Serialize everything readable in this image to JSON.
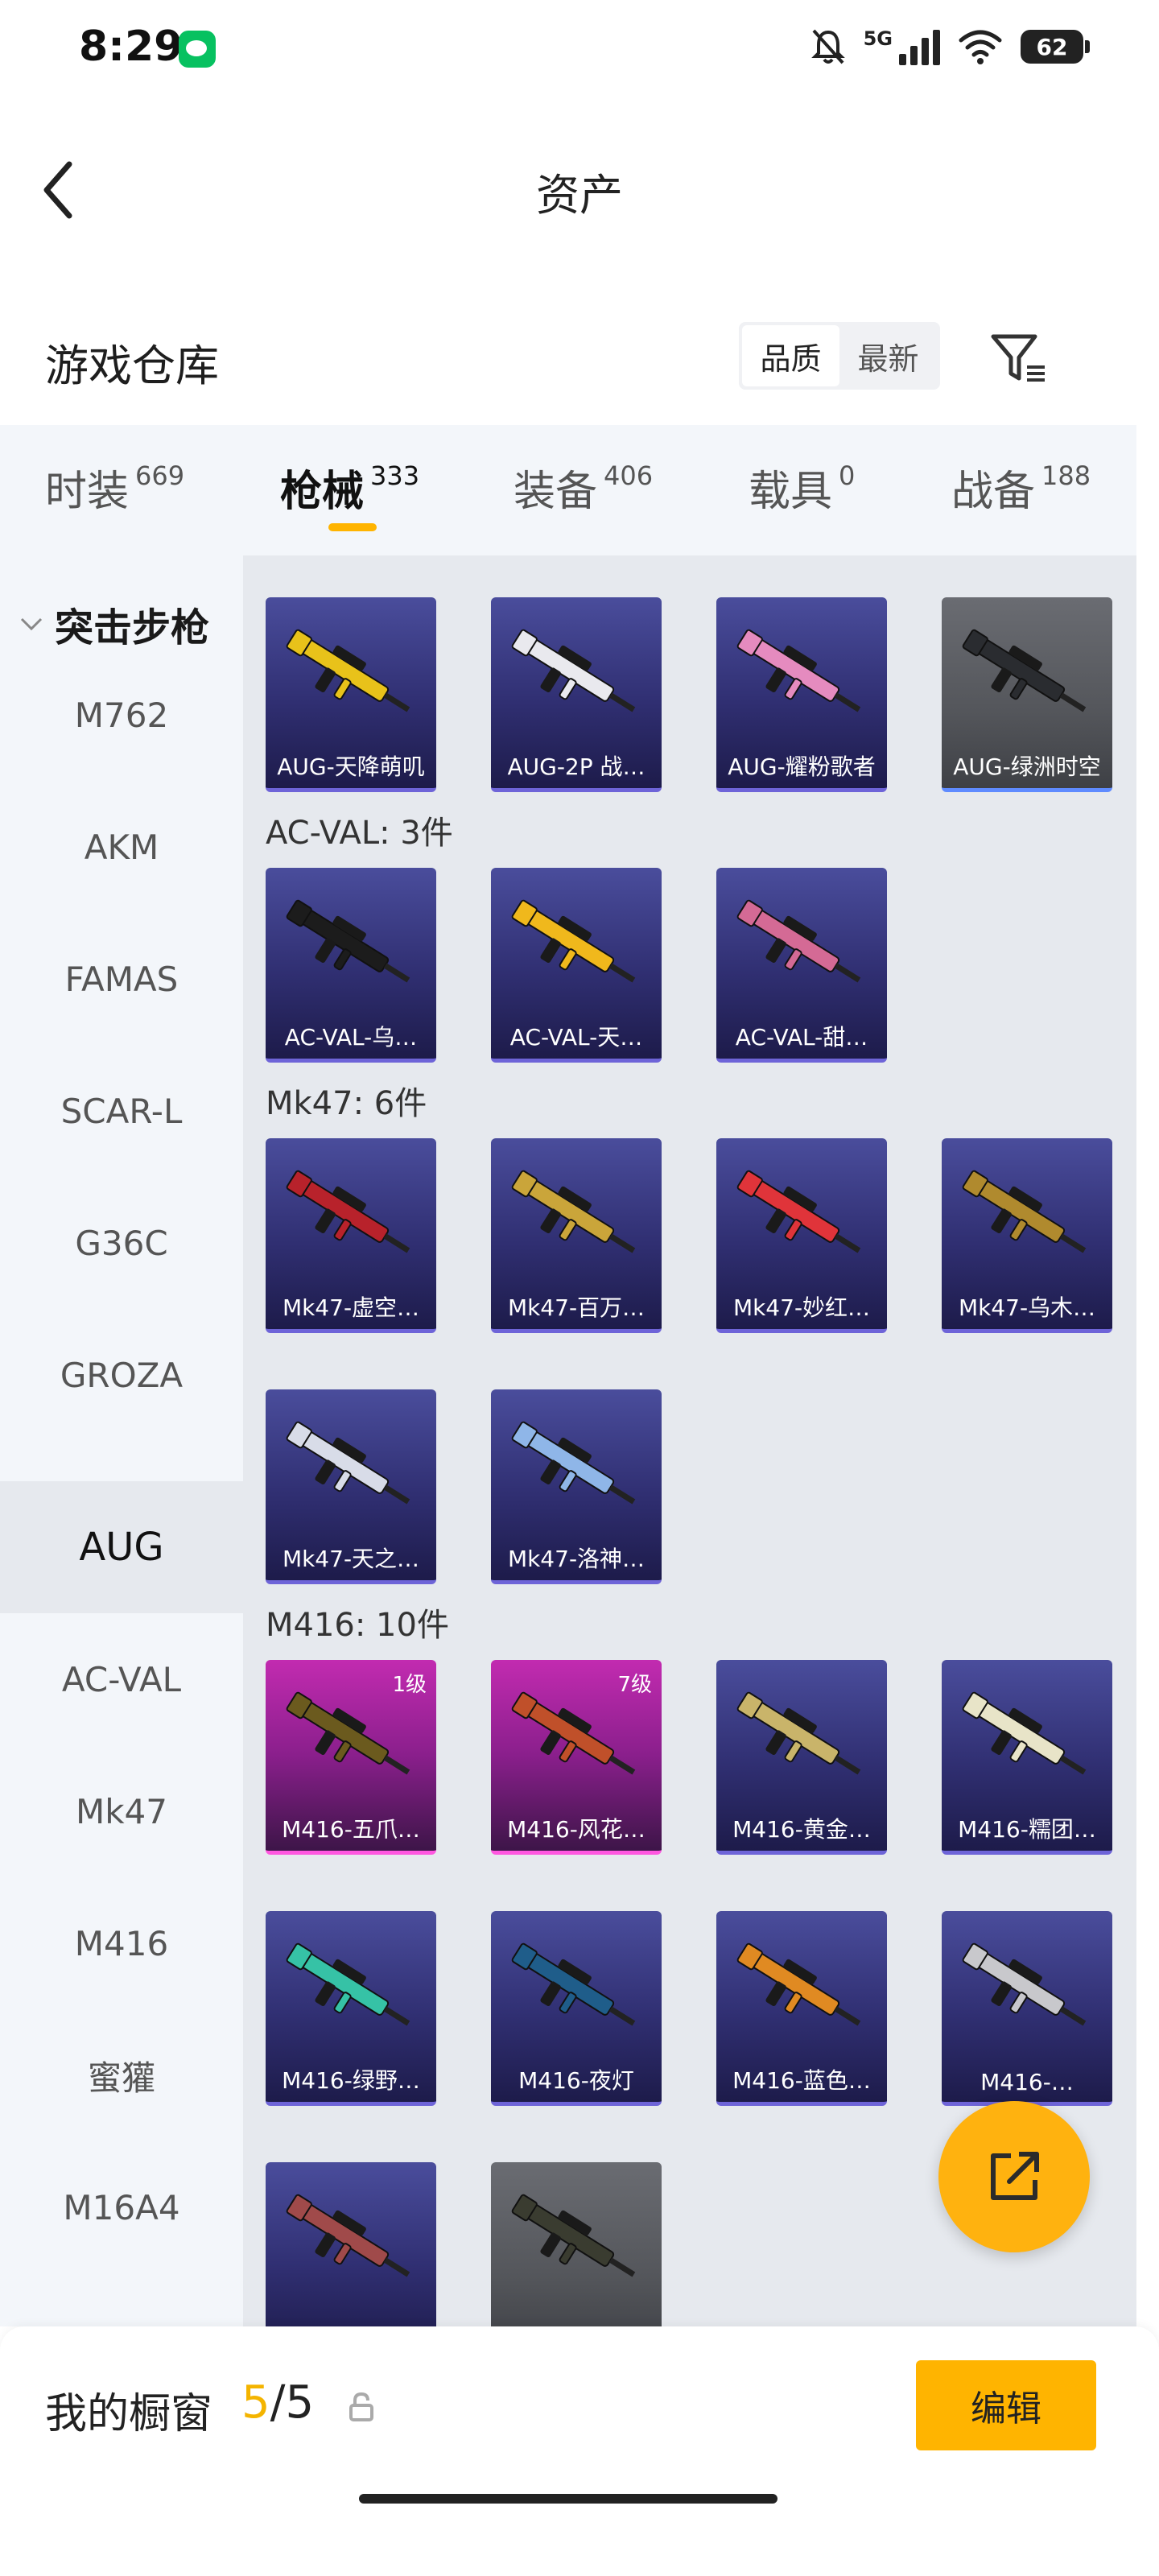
{
  "status_bar": {
    "time": "8:29",
    "network": "5G",
    "battery": "62"
  },
  "header": {
    "title": "资产"
  },
  "warehouse": {
    "title": "游戏仓库",
    "sort_options": [
      "品质",
      "最新"
    ],
    "active_sort": "品质"
  },
  "tabs": [
    {
      "label": "时装",
      "count": "669"
    },
    {
      "label": "枪械",
      "count": "333"
    },
    {
      "label": "装备",
      "count": "406"
    },
    {
      "label": "载具",
      "count": "0"
    },
    {
      "label": "战备",
      "count": "188"
    }
  ],
  "active_tab": "枪械",
  "sidebar": {
    "header": "突击步枪",
    "items": [
      "M762",
      "AKM",
      "FAMAS",
      "SCAR-L",
      "G36C",
      "GROZA",
      "AUG",
      "AC-VAL",
      "Mk47",
      "M416",
      "蜜獾",
      "M16A4"
    ],
    "active_item": "AUG"
  },
  "groups": [
    {
      "label": "",
      "items": [
        {
          "name": "AUG-天降萌叽",
          "style": "blue",
          "gun_color": "#e8c21a"
        },
        {
          "name": "AUG-2P 战…",
          "style": "blue",
          "gun_color": "#e9e9ee"
        },
        {
          "name": "AUG-耀粉歌者",
          "style": "blue",
          "gun_color": "#e58bbf"
        },
        {
          "name": "AUG-绿洲时空",
          "style": "gray",
          "gun_color": "#2a2c30"
        }
      ]
    },
    {
      "label": "AC-VAL: 3件",
      "items": [
        {
          "name": "AC-VAL-乌…",
          "style": "blue",
          "gun_color": "#1c1c1c"
        },
        {
          "name": "AC-VAL-天…",
          "style": "blue",
          "gun_color": "#f0b81c"
        },
        {
          "name": "AC-VAL-甜…",
          "style": "blue",
          "gun_color": "#d46a95"
        }
      ]
    },
    {
      "label": "Mk47: 6件",
      "items": [
        {
          "name": "Mk47-虚空…",
          "style": "blue",
          "gun_color": "#b8222b"
        },
        {
          "name": "Mk47-百万…",
          "style": "blue",
          "gun_color": "#caa53a"
        },
        {
          "name": "Mk47-妙红…",
          "style": "blue",
          "gun_color": "#e0343a"
        },
        {
          "name": "Mk47-乌木…",
          "style": "blue",
          "gun_color": "#b08a2e"
        },
        {
          "name": "Mk47-天之…",
          "style": "blue",
          "gun_color": "#d8dce8"
        },
        {
          "name": "Mk47-洛神…",
          "style": "blue",
          "gun_color": "#8fb6e8"
        }
      ]
    },
    {
      "label": "M416: 10件",
      "items": [
        {
          "name": "M416-五爪…",
          "style": "purple",
          "level": "1级",
          "gun_color": "#6b5a1e"
        },
        {
          "name": "M416-风花…",
          "style": "purple",
          "level": "7级",
          "gun_color": "#c0502a"
        },
        {
          "name": "M416-黄金…",
          "style": "blue",
          "gun_color": "#c9b46a"
        },
        {
          "name": "M416-糯团…",
          "style": "blue",
          "gun_color": "#e8e4c8"
        },
        {
          "name": "M416-绿野…",
          "style": "blue",
          "gun_color": "#36c2a6"
        },
        {
          "name": "M416-夜灯",
          "style": "blue",
          "gun_color": "#1f5d8a"
        },
        {
          "name": "M416-蓝色…",
          "style": "blue",
          "gun_color": "#e08a22"
        },
        {
          "name": "M416-…",
          "style": "blue",
          "gun_color": "#c8c8cc"
        },
        {
          "name": "",
          "style": "blue",
          "gun_color": "#a04a4a"
        },
        {
          "name": "",
          "style": "gray",
          "gun_color": "#3a3c30"
        }
      ]
    }
  ],
  "showcase": {
    "label": "我的橱窗",
    "current": "5",
    "total": "5"
  },
  "bottom": {
    "edit_label": "编辑"
  },
  "icons": {
    "back": "chevron-left-icon",
    "filter": "filter-icon",
    "share": "external-link-icon",
    "lock": "lock-icon"
  },
  "colors": {
    "accent": "#ffb400"
  }
}
